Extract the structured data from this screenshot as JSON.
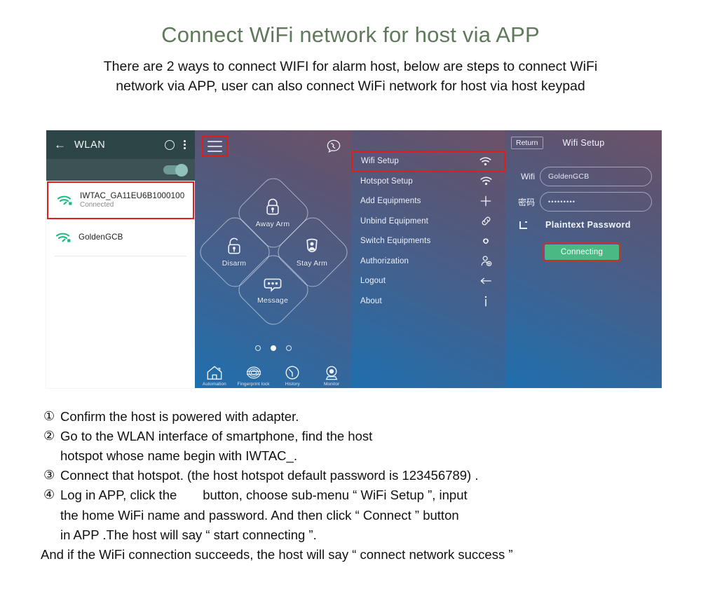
{
  "header": {
    "title": "Connect WiFi network for host via APP",
    "title_color": "#5f7a5a",
    "intro_line1": "There are 2 ways to connect WIFI for alarm host, below are steps to connect WiFi",
    "intro_line2": "network via APP, user can also connect WiFi network for host via host keypad"
  },
  "phone1": {
    "title": "WLAN",
    "back_icon": "arrow-left-icon",
    "circle_icon": "circle-icon",
    "overflow_icon": "overflow-menu-icon",
    "toggle_state": "on",
    "networks": [
      {
        "ssid": "IWTAC_GA11EU6B1000100",
        "status": "Connected",
        "highlighted": true
      },
      {
        "ssid": "GoldenGCB",
        "status": "",
        "highlighted": false
      }
    ]
  },
  "phone2": {
    "menu_icon": "hamburger-menu-icon",
    "menu_highlighted": true,
    "call_icon": "call-bubble-icon",
    "tiles": [
      {
        "label": "Away Arm",
        "icon": "lock-closed-icon"
      },
      {
        "label": "Disarm",
        "icon": "lock-open-icon"
      },
      {
        "label": "Stay Arm",
        "icon": "person-shield-icon"
      },
      {
        "label": "Message",
        "icon": "chat-bubble-icon"
      }
    ],
    "pager": {
      "count": 3,
      "active_index": 1
    },
    "nav": [
      {
        "label": "Automation",
        "icon": "home-icon"
      },
      {
        "label": "Fingerprint lock",
        "icon": "fingerprint-lock-icon"
      },
      {
        "label": "History",
        "icon": "clock-icon"
      },
      {
        "label": "Monitor",
        "icon": "camera-icon"
      }
    ]
  },
  "phone3": {
    "items": [
      {
        "label": "Wifi Setup",
        "icon": "wifi-icon",
        "highlighted": true
      },
      {
        "label": "Hotspot Setup",
        "icon": "wifi-icon",
        "highlighted": false
      },
      {
        "label": "Add Equipments",
        "icon": "plus-icon",
        "highlighted": false
      },
      {
        "label": "Unbind Equipment",
        "icon": "link-icon",
        "highlighted": false
      },
      {
        "label": "Switch Equipments",
        "icon": "infinity-icon",
        "highlighted": false
      },
      {
        "label": "Authorization",
        "icon": "user-add-icon",
        "highlighted": false
      },
      {
        "label": "Logout",
        "icon": "arrow-left-icon",
        "highlighted": false
      },
      {
        "label": "About",
        "icon": "info-icon",
        "highlighted": false
      }
    ]
  },
  "phone4": {
    "return_label": "Return",
    "title": "Wifi Setup",
    "wifi_label": "Wifi",
    "wifi_value": "GoldenGCB",
    "password_label": "密码",
    "password_value": "•••••••••",
    "plaintext_label": "Plaintext Password",
    "plaintext_checked": false,
    "button_label": "Connecting",
    "button_color": "#4bb983",
    "button_highlight_color": "#c9312b"
  },
  "steps": [
    {
      "num": "①",
      "lines": [
        "Confirm the host is powered with adapter."
      ]
    },
    {
      "num": "②",
      "lines": [
        "Go to the WLAN interface of smartphone, find the host",
        "hotspot whose name begin with IWTAC_."
      ]
    },
    {
      "num": "③",
      "lines": [
        "Connect that hotspot. (the host hotspot default password is 123456789) ."
      ]
    },
    {
      "num": "④",
      "lines": [
        "Log in APP, click the  button, choose sub-menu “ WiFi Setup ”, input",
        "the home WiFi name and password. And then click “ Connect ” button",
        "in APP .The host will say “  start connecting ”."
      ]
    }
  ],
  "footer_note": "And if the WiFi connection succeeds, the host will say “ connect network success ”"
}
